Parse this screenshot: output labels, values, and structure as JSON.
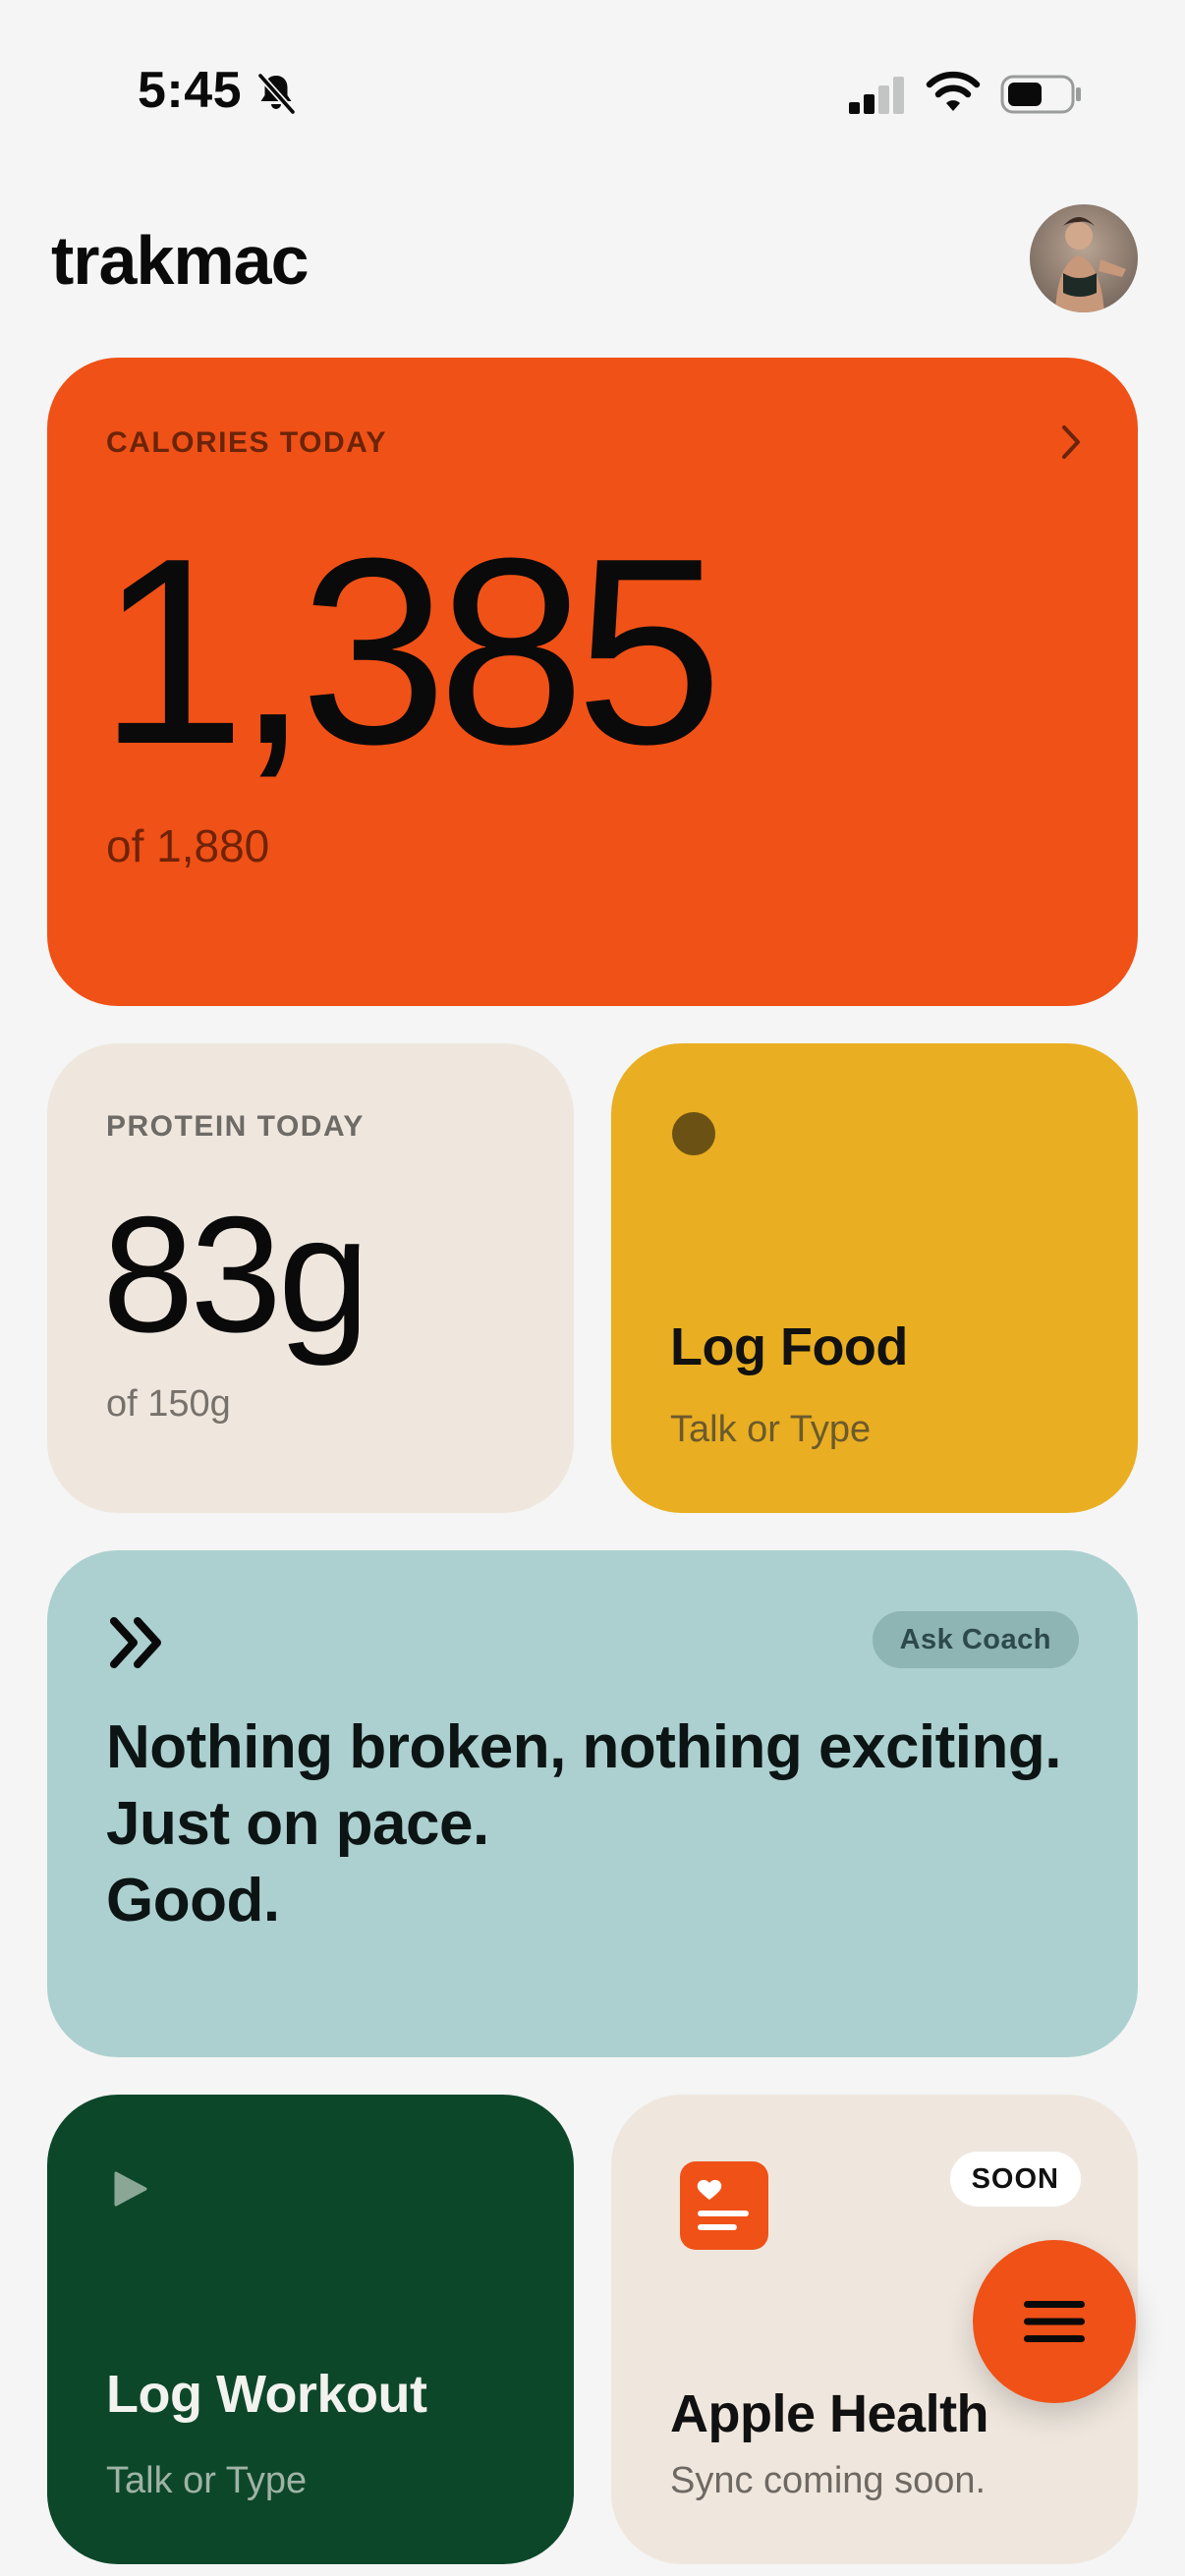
{
  "status_bar": {
    "time": "5:45",
    "icons": [
      "bell-slash-icon",
      "cellular-signal-icon",
      "wifi-icon",
      "battery-icon"
    ]
  },
  "header": {
    "title": "trakmac",
    "avatar_icon": "profile-avatar"
  },
  "calories_card": {
    "label": "CALORIES TODAY",
    "value": "1,385",
    "sub": "of 1,880",
    "color": "#f05117"
  },
  "protein_card": {
    "label": "PROTEIN TODAY",
    "value": "83g",
    "sub": "of 150g",
    "color": "#efe7de"
  },
  "log_food_card": {
    "title": "Log Food",
    "sub": "Talk or Type",
    "color": "#e9ae22"
  },
  "coach_card": {
    "chip_label": "Ask Coach",
    "lines": [
      "Nothing broken, nothing exciting.",
      "Just on pace.",
      "Good."
    ],
    "color": "#acd0d0"
  },
  "log_workout_card": {
    "title": "Log Workout",
    "sub": "Talk or Type",
    "color": "#0d472a"
  },
  "apple_health_card": {
    "badge": "SOON",
    "title": "Apple Health",
    "sub": "Sync coming soon.",
    "icon": "health-record-icon",
    "color": "#efe7de"
  },
  "fab": {
    "icon": "menu-icon",
    "color": "#f05117"
  }
}
